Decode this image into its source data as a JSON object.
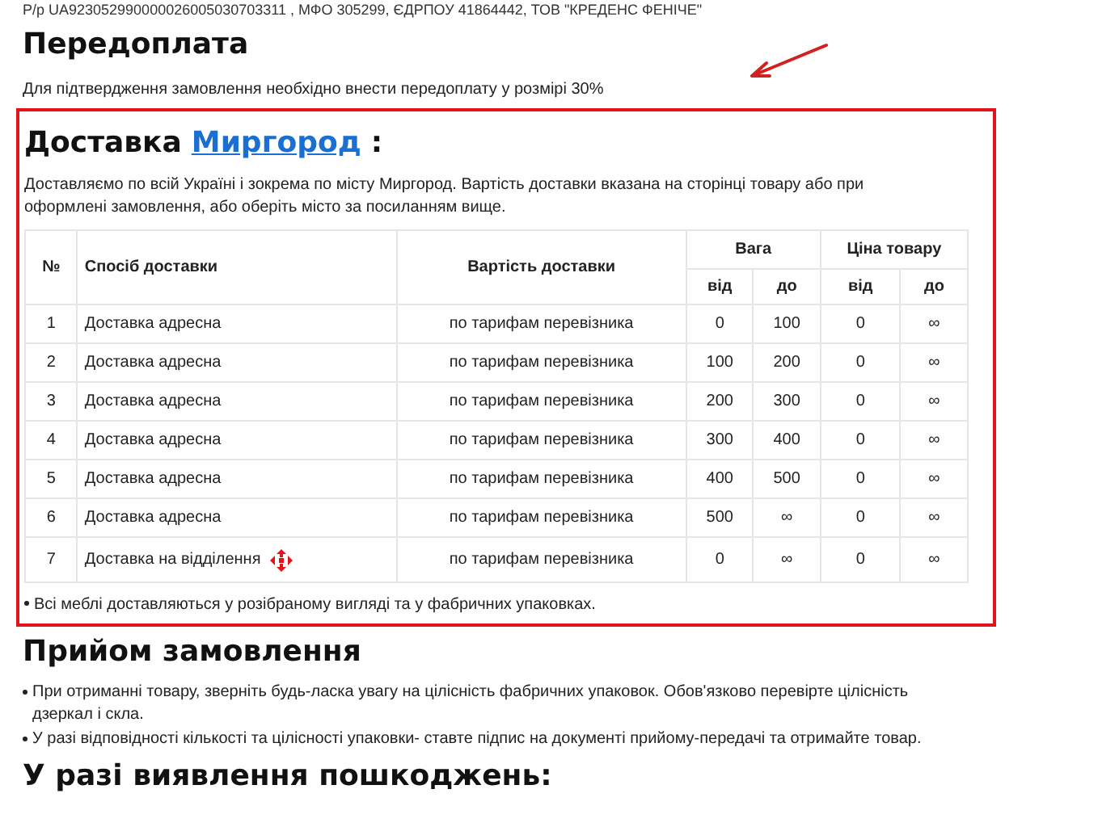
{
  "top_line": "Р/р UA923052990000026005030703311 , МФО 305299, ЄДРПОУ 41864442, ТОВ \"КРЕДЕНС ФЕНІЧЕ\"",
  "prepayment": {
    "title": "Передоплата",
    "text": "Для підтвердження замовлення необхідно внести передоплату у розмірі 30%"
  },
  "delivery": {
    "title": "Доставка",
    "city_link": "Миргород",
    "colon": ":",
    "text": "Доставляємо по всій Україні і зокрема по місту Миргород. Вартість доставки вказана на сторінці товару або при оформлені замовлення, або оберіть місто за посиланням вище.",
    "table": {
      "columns": [
        {
          "label": "№"
        },
        {
          "label": "Спосіб доставки"
        },
        {
          "label": "Вартість доставки"
        },
        {
          "label": "Вага",
          "colspan": 2
        },
        {
          "label": "Ціна товару",
          "colspan": 2
        }
      ],
      "subcolumns": [
        "від",
        "до",
        "від",
        "до"
      ],
      "rows": [
        {
          "cells": [
            "1",
            "Доставка адресна",
            "по тарифам перевізника",
            "0",
            "100",
            "0",
            "∞"
          ],
          "carrier_icon": false
        },
        {
          "cells": [
            "2",
            "Доставка адресна",
            "по тарифам перевізника",
            "100",
            "200",
            "0",
            "∞"
          ],
          "carrier_icon": false
        },
        {
          "cells": [
            "3",
            "Доставка адресна",
            "по тарифам перевізника",
            "200",
            "300",
            "0",
            "∞"
          ],
          "carrier_icon": false
        },
        {
          "cells": [
            "4",
            "Доставка адресна",
            "по тарифам перевізника",
            "300",
            "400",
            "0",
            "∞"
          ],
          "carrier_icon": false
        },
        {
          "cells": [
            "5",
            "Доставка адресна",
            "по тарифам перевізника",
            "400",
            "500",
            "0",
            "∞"
          ],
          "carrier_icon": false
        },
        {
          "cells": [
            "6",
            "Доставка адресна",
            "по тарифам перевізника",
            "500",
            "∞",
            "0",
            "∞"
          ],
          "carrier_icon": false
        },
        {
          "cells": [
            "7",
            "Доставка на відділення",
            "по тарифам перевізника",
            "0",
            "∞",
            "0",
            "∞"
          ],
          "carrier_icon": true
        }
      ]
    },
    "note": "Всі меблі доставляються у розібраному вигляді та у фабричних упаковках."
  },
  "receipt": {
    "title": "Прийом замовлення",
    "items": [
      "При отриманні товару, зверніть будь-ласка увагу на цілісність фабричних упаковок. Обов'язково перевірте цілісність дзеркал і скла.",
      "У разі відповідності кількості та цілісності упаковки- ставте підпис на документі прийому-передачі та отримайте товар."
    ]
  },
  "damage": {
    "title": "У разі виявлення пошкоджень:"
  }
}
